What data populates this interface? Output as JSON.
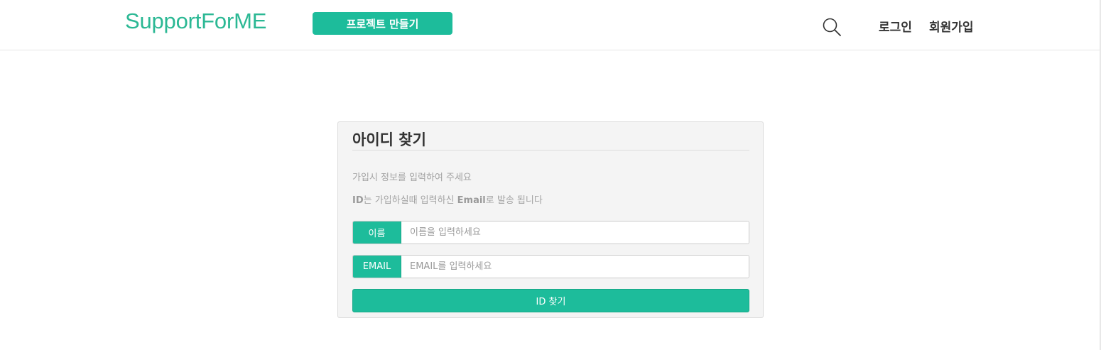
{
  "header": {
    "logo": "SupportForME",
    "create_project_label": "프로젝트 만들기",
    "search_icon": "search-icon",
    "login_label": "로그인",
    "signup_label": "회원가입"
  },
  "find_id": {
    "title": "아이디 찾기",
    "info_line1": "가입시 정보를 입력하여 주세요",
    "info_line2": {
      "id_term": "ID",
      "part1": "는 가입하실때 입력하신 ",
      "email_term": "Email",
      "part2": "로 발송 됩니다"
    },
    "name_field": {
      "label": "이름",
      "value": "",
      "placeholder": "이름을 입력하세요"
    },
    "email_field": {
      "label": "EMAIL",
      "value": "",
      "placeholder": "EMAIL를 입력하세요"
    },
    "submit_label": "ID 찾기"
  },
  "colors": {
    "accent": "#1dbc9b",
    "logo": "#2bb894",
    "card_background": "#f4f4f4",
    "muted_text": "#a3a3a3"
  }
}
